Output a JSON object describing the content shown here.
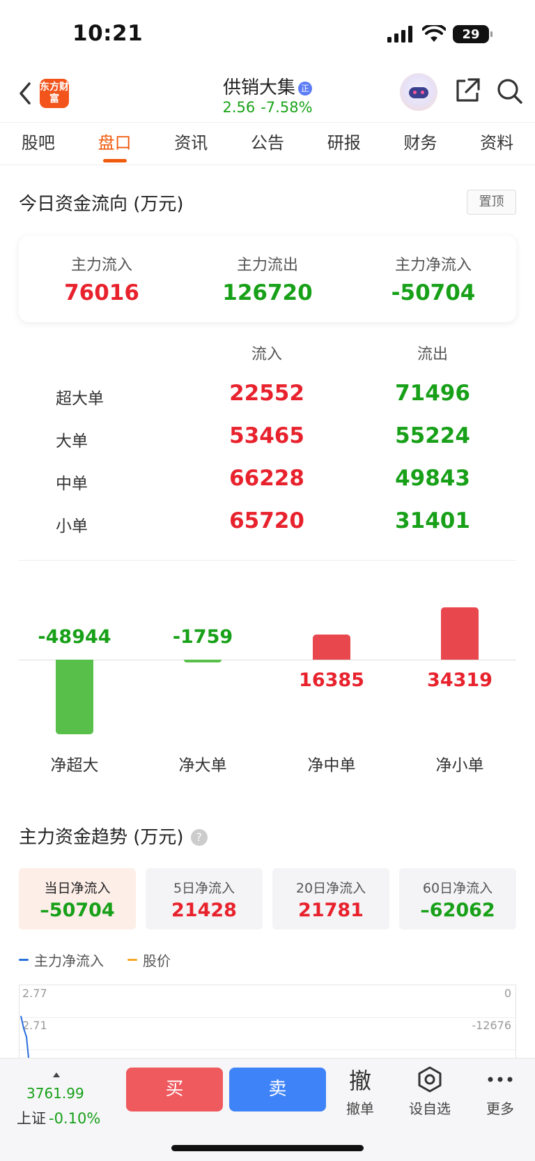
{
  "status_bar": {
    "time": "10:21",
    "battery": "29"
  },
  "header": {
    "logo_text": "东方财富",
    "stock_name": "供销大集",
    "verify_badge": "正",
    "price": "2.56",
    "change_pct": "-7.58%"
  },
  "tabs": [
    "股吧",
    "盘口",
    "资讯",
    "公告",
    "研报",
    "财务",
    "资料"
  ],
  "active_tab": "盘口",
  "fund_flow": {
    "title": "今日资金流向 (万元)",
    "pin_label": "置顶",
    "summary": [
      {
        "label": "主力流入",
        "value": "76016",
        "color": "#e8222d"
      },
      {
        "label": "主力流出",
        "value": "126720",
        "color": "#17a018"
      },
      {
        "label": "主力净流入",
        "value": "-50704",
        "color": "#17a018"
      }
    ],
    "columns": {
      "inflow": "流入",
      "outflow": "流出"
    },
    "rows": [
      {
        "label": "超大单",
        "inflow": "22552",
        "outflow": "71496"
      },
      {
        "label": "大单",
        "inflow": "53465",
        "outflow": "55224"
      },
      {
        "label": "中单",
        "inflow": "66228",
        "outflow": "49843"
      },
      {
        "label": "小单",
        "inflow": "65720",
        "outflow": "31401"
      }
    ]
  },
  "chart_data": {
    "type": "bar",
    "categories": [
      "净超大",
      "净大单",
      "净中单",
      "净小单"
    ],
    "values": [
      -48944,
      -1759,
      16385,
      34319
    ],
    "labels": [
      "-48944",
      "-1759",
      "16385",
      "34319"
    ],
    "colors": {
      "positive": "#e8474d",
      "negative": "#58c04a"
    }
  },
  "trend": {
    "title": "主力资金趋势 (万元)",
    "help": "?",
    "periods": [
      {
        "label": "当日净流入",
        "value": "–50704",
        "color": "#17a018"
      },
      {
        "label": "5日净流入",
        "value": "21428",
        "color": "#e8222d"
      },
      {
        "label": "20日净流入",
        "value": "21781",
        "color": "#e8222d"
      },
      {
        "label": "60日净流入",
        "value": "–62062",
        "color": "#17a018"
      }
    ],
    "legend": [
      {
        "label": "主力净流入",
        "color": "#2a6fdb"
      },
      {
        "label": "股价",
        "color": "#f5a623"
      }
    ],
    "left_axis": [
      "2.77",
      "2.71"
    ],
    "right_axis": [
      "0",
      "-12676"
    ]
  },
  "bottom_bar": {
    "index_value": "3761.99",
    "index_name": "上证",
    "index_change": "-0.10%",
    "buy": "买",
    "sell": "卖",
    "cancel_icon": "撤",
    "cancel_label": "撤单",
    "watch_label": "设自选",
    "more_label": "更多"
  }
}
